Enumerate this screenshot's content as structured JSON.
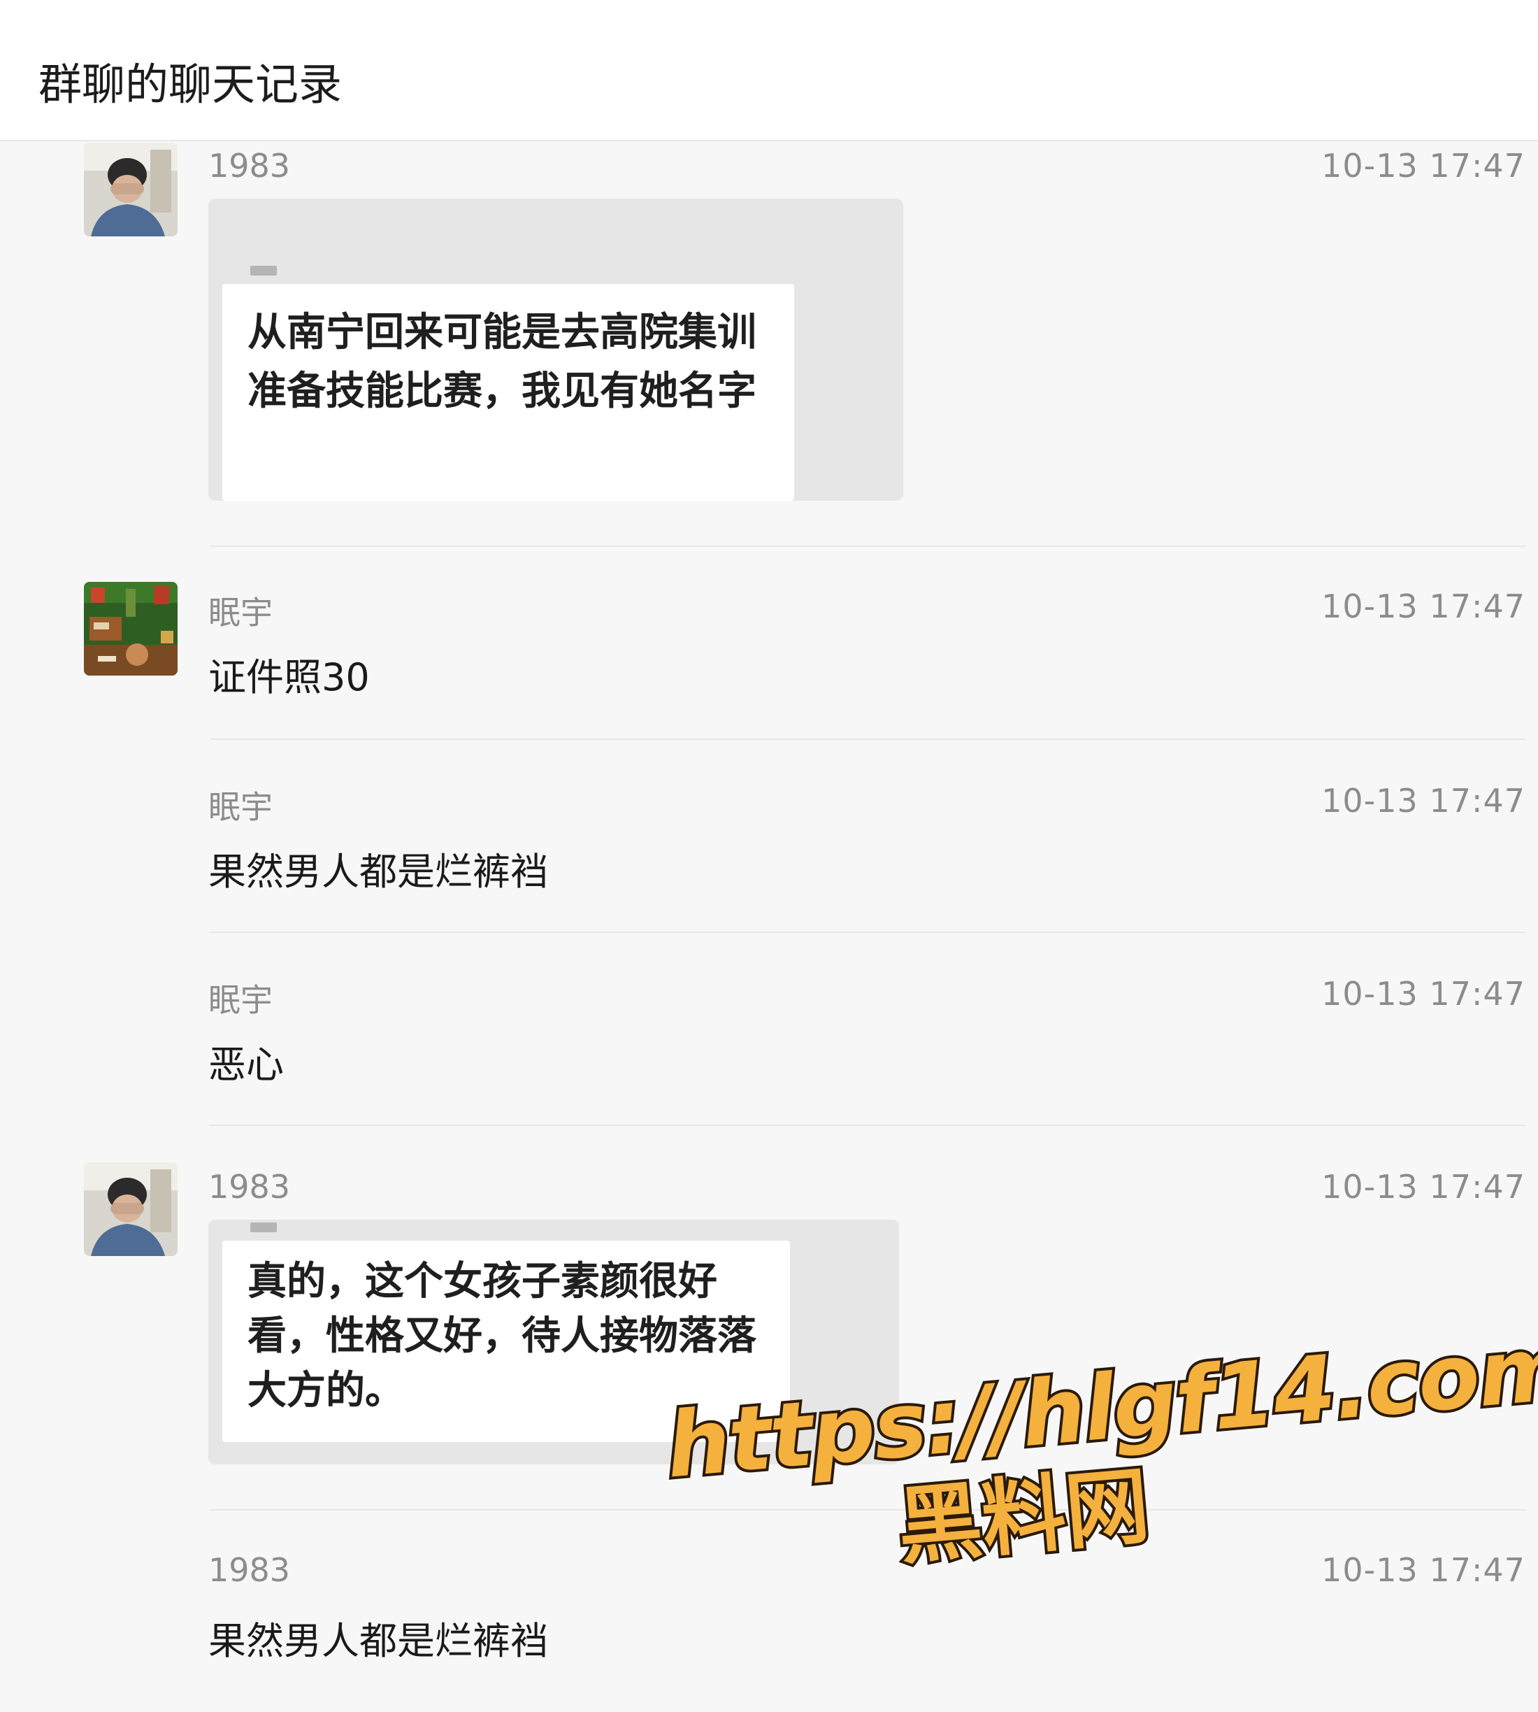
{
  "header": {
    "title": "群聊的聊天记录"
  },
  "messages": [
    {
      "sender": "1983",
      "time": "10-13 17:47",
      "avatar": "person-covering-face",
      "type": "quote",
      "text": "从南宁回来可能是去高院集训准备技能比赛，我见有她名字"
    },
    {
      "sender": "眠宇",
      "time": "10-13 17:47",
      "avatar": "pixel-game-scene",
      "type": "text",
      "text": "证件照30"
    },
    {
      "sender": "眠宇",
      "time": "10-13 17:47",
      "type": "text",
      "text": "果然男人都是烂裤裆"
    },
    {
      "sender": "眠宇",
      "time": "10-13 17:47",
      "type": "text",
      "text": "恶心"
    },
    {
      "sender": "1983",
      "time": "10-13 17:47",
      "avatar": "person-covering-face",
      "type": "quote",
      "text": "真的，这个女孩子素颜很好看，性格又好，待人接物落落大方的。"
    },
    {
      "sender": "1983",
      "time": "10-13 17:47",
      "type": "text",
      "text": "果然男人都是烂裤裆"
    }
  ],
  "watermark": {
    "url": "https://hlgf14.com",
    "name": "黑料网"
  },
  "colors": {
    "accent_orange": "#f5b13d",
    "meta_gray": "#8c8c8c"
  }
}
